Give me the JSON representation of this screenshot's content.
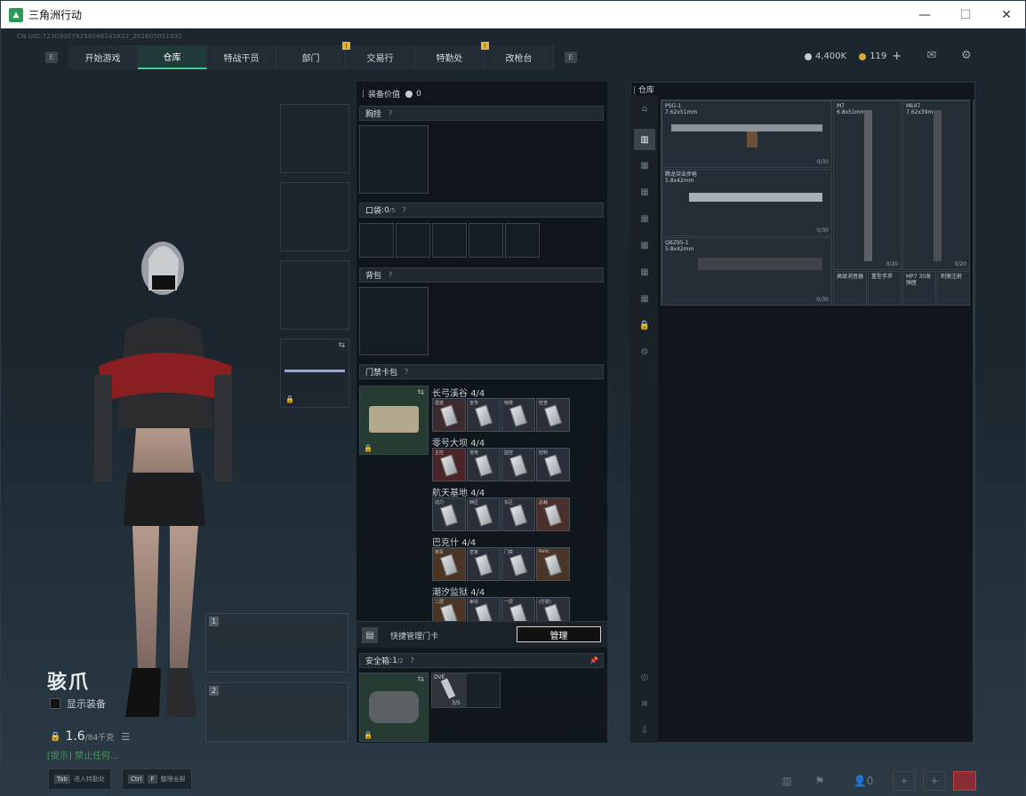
{
  "window": {
    "title": "三角洲行动",
    "min": "—",
    "max": "☐",
    "close": "✕"
  },
  "uid": "CN UID:723030078256046145832_202605051032",
  "nav": {
    "left_key": "E",
    "right_key": "E",
    "tabs": [
      {
        "label": "开始游戏",
        "active": false,
        "badge": ""
      },
      {
        "label": "仓库",
        "active": true,
        "badge": ""
      },
      {
        "label": "特战干员",
        "active": false,
        "badge": ""
      },
      {
        "label": "部门",
        "active": false,
        "badge": "!"
      },
      {
        "label": "交易行",
        "active": false,
        "badge": ""
      },
      {
        "label": "特勤处",
        "active": false,
        "badge": "!"
      },
      {
        "label": "改枪台",
        "active": false,
        "badge": ""
      }
    ]
  },
  "currency": {
    "silver": "4,400K",
    "gold": "119",
    "plus": "+"
  },
  "character": {
    "name": "骇爪",
    "show_gear": "显示装备",
    "weight": "1.6",
    "weight_max": "/84千克",
    "map_note": "[提示] 禁止任何..."
  },
  "bottom_keys": [
    {
      "key": "Tab",
      "label": "进入特勤处"
    },
    {
      "key": "Ctrl",
      "key2": "F",
      "label": "整理全部"
    }
  ],
  "mid": {
    "equip_value_label": "装备价值",
    "equip_value": "0",
    "chest": "胸挂",
    "pocket": "口袋",
    "pocket_count": "0",
    "pocket_max": "/5",
    "backpack": "背包",
    "cardpack": "门禁卡包",
    "q": "?",
    "maps": [
      {
        "name": "长弓溪谷",
        "count": "4/4",
        "cards": [
          "遗迹",
          "宣传",
          "哨塔",
          "检查"
        ],
        "tone": [
          "#3b2a2e",
          "#2b2f3a",
          "#2b2f3a",
          "#2b2f3a"
        ]
      },
      {
        "name": "零号大坝",
        "count": "4/4",
        "cards": [
          "主控",
          "变电",
          "监控",
          "控制"
        ],
        "tone": [
          "#4a2429",
          "#2b2f3a",
          "#2b2f3a",
          "#2b2f3a"
        ]
      },
      {
        "name": "航天基地",
        "count": "4/4",
        "cards": [
          "动力",
          "西区",
          "东区",
          "总裁"
        ],
        "tone": [
          "#2b2f3a",
          "#2b2f3a",
          "#2b2f3a",
          "#4a2f2a"
        ]
      },
      {
        "name": "巴克什",
        "count": "4/4",
        "cards": [
          "将军",
          "皇家",
          "门禁",
          "Relic"
        ],
        "tone": [
          "#4a3526",
          "#2b2f3a",
          "#2b2f3a",
          "#4a3526"
        ]
      },
      {
        "name": "潮汐监狱",
        "count": "4/4",
        "cards": [
          "二层",
          "审讯",
          "一层",
          "(付费)"
        ],
        "tone": [
          "#4a3526",
          "#2b2f3a",
          "#2b2f3a",
          "#2b2f3a"
        ]
      }
    ],
    "quick_manage": "快捷管理门卡",
    "manage_btn": "管理",
    "safebox": "安全箱",
    "safebox_count": "1",
    "safebox_max": "/2",
    "safebox_item": "DVE",
    "safebox_item_count": "3/5"
  },
  "storage": {
    "label": "仓库",
    "weapons": [
      {
        "name": "PSG-1",
        "cal": "7.62x51mm",
        "ammo": "0/30"
      },
      {
        "name": "M7",
        "cal": "6.8x51mm",
        "ammo": "0/20"
      },
      {
        "name": "Mk47",
        "cal": "7.62x39mm",
        "ammo": "0/20"
      },
      {
        "name": "腾龙突击步枪",
        "cal": "5.8x42mm",
        "ammo": "0/30"
      },
      {
        "name": "QBZ95-1",
        "cal": "5.8x42mm",
        "ammo": "0/30"
      }
    ],
    "small": [
      {
        "name": "高级消音器"
      },
      {
        "name": "重型手斧"
      },
      {
        "name": "MP7\n30发弹匣"
      },
      {
        "name": "刺激注射"
      }
    ]
  },
  "colors": {
    "accent": "#3fd08a",
    "badge": "#e0b33a"
  }
}
